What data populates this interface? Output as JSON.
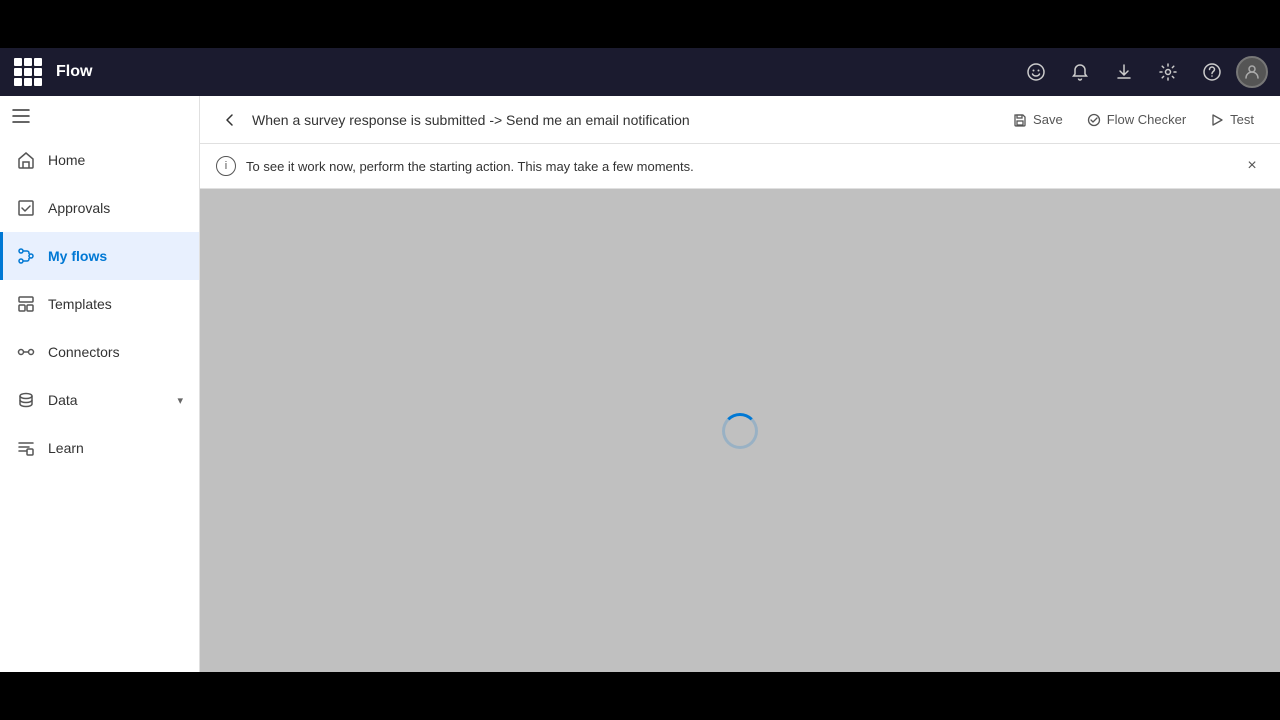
{
  "app": {
    "title": "Flow"
  },
  "header": {
    "apps_icon": "apps-icon",
    "title": "Flow",
    "icons": [
      {
        "name": "feedback-icon",
        "symbol": "🙂"
      },
      {
        "name": "notification-icon",
        "symbol": "🔔"
      },
      {
        "name": "download-icon",
        "symbol": "⬇"
      },
      {
        "name": "settings-icon",
        "symbol": "⚙"
      },
      {
        "name": "help-icon",
        "symbol": "?"
      },
      {
        "name": "user-avatar",
        "symbol": "👤"
      }
    ]
  },
  "sidebar": {
    "collapse_label": "≡",
    "items": [
      {
        "id": "home",
        "label": "Home",
        "icon": "home-icon"
      },
      {
        "id": "approvals",
        "label": "Approvals",
        "icon": "approvals-icon"
      },
      {
        "id": "my-flows",
        "label": "My flows",
        "icon": "my-flows-icon",
        "active": true
      },
      {
        "id": "templates",
        "label": "Templates",
        "icon": "templates-icon"
      },
      {
        "id": "connectors",
        "label": "Connectors",
        "icon": "connectors-icon"
      },
      {
        "id": "data",
        "label": "Data",
        "icon": "data-icon",
        "has_chevron": true
      },
      {
        "id": "learn",
        "label": "Learn",
        "icon": "learn-icon"
      }
    ]
  },
  "flow_header": {
    "back_label": "←",
    "title": "When a survey response is submitted -> Send me an email notification",
    "actions": [
      {
        "id": "save",
        "label": "Save",
        "icon": "💾"
      },
      {
        "id": "flow-checker",
        "label": "Flow Checker",
        "icon": "✓"
      },
      {
        "id": "test",
        "label": "Test",
        "icon": "✏"
      }
    ]
  },
  "info_banner": {
    "text": "To see it work now, perform the starting action. This may take a few moments.",
    "close_label": "×"
  },
  "canvas": {
    "loading": true
  }
}
